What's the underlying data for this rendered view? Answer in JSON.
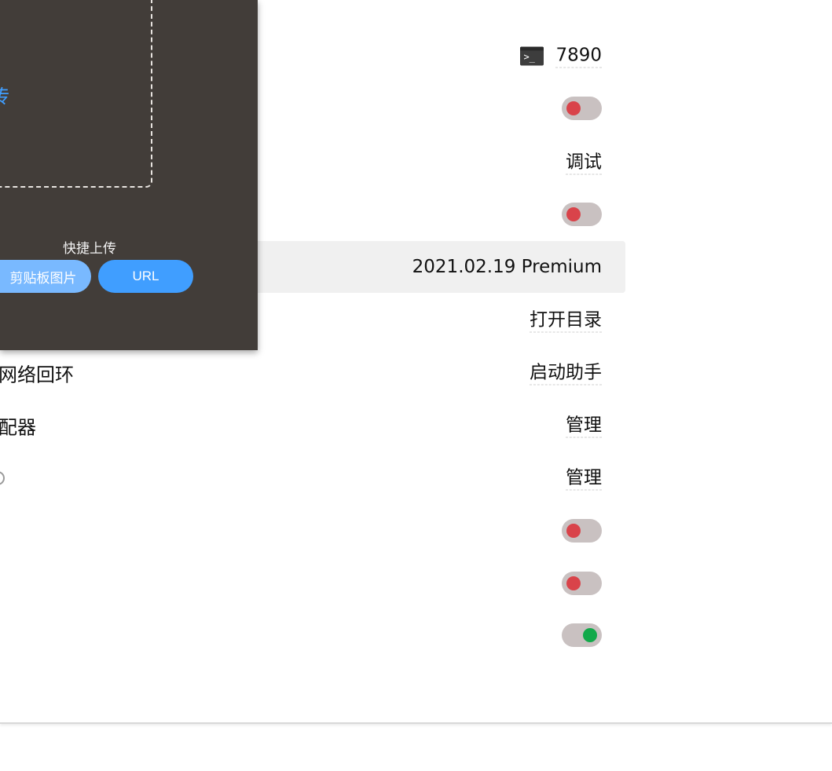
{
  "upload": {
    "drop_text": "传",
    "quick_title": "快捷上传",
    "clipboard_label": "剪贴板图片",
    "url_label": "URL"
  },
  "settings": {
    "port": {
      "icon": "terminal-icon",
      "value": "7890"
    },
    "toggle1": {
      "state": "off"
    },
    "debug": {
      "link": "调试"
    },
    "toggle2": {
      "state": "off"
    },
    "version": {
      "value": "2021.02.19 Premium"
    },
    "directory": {
      "link": "打开目录"
    },
    "loopback": {
      "label": "网络回环",
      "link": "启动助手"
    },
    "adapter": {
      "label": "配器",
      "link": "管理"
    },
    "manage2": {
      "link": "管理"
    },
    "toggle3": {
      "state": "off"
    },
    "toggle4": {
      "state": "off"
    },
    "toggle5": {
      "state": "on"
    }
  },
  "colors": {
    "accent": "#409eff",
    "toggle_track": "#c9c1c1",
    "toggle_off_knob": "#d9434a",
    "toggle_on_knob": "#12a94a",
    "overlay_bg": "#423d39"
  }
}
